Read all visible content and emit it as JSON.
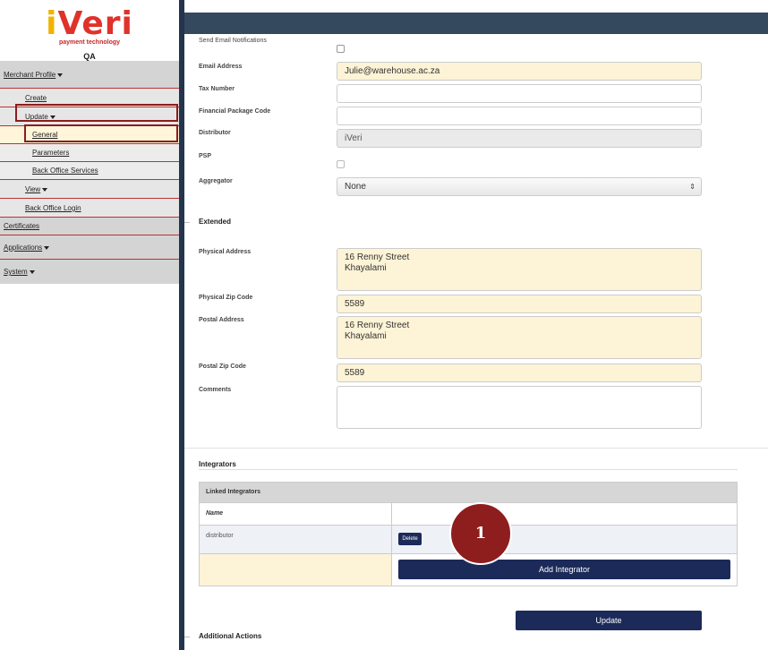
{
  "logo": {
    "text_i": "i",
    "text_rest": "Veri",
    "tagline": "payment technology"
  },
  "environment": "QA",
  "nav": {
    "merchant_profile": "Merchant Profile",
    "create": "Create",
    "update": "Update",
    "general": "General",
    "parameters": "Parameters",
    "back_office_services": "Back Office Services",
    "view": "View",
    "back_office_login": "Back Office Login",
    "certificates": "Certificates",
    "applications": "Applications",
    "system": "System"
  },
  "form": {
    "send_email_notifications": {
      "label": "Send Email Notifications",
      "checked": false
    },
    "email_address": {
      "label": "Email Address",
      "value": "Julie@warehouse.ac.za"
    },
    "tax_number": {
      "label": "Tax Number",
      "value": ""
    },
    "financial_package_code": {
      "label": "Financial Package Code",
      "value": ""
    },
    "distributor": {
      "label": "Distributor",
      "value": "iVeri"
    },
    "psp": {
      "label": "PSP",
      "checked": false
    },
    "aggregator": {
      "label": "Aggregator",
      "value": "None"
    },
    "extended_section": "Extended",
    "physical_address": {
      "label": "Physical Address",
      "value": "16 Renny Street\nKhayalami"
    },
    "physical_zip": {
      "label": "Physical Zip Code",
      "value": "5589"
    },
    "postal_address": {
      "label": "Postal Address",
      "value": "16 Renny Street\nKhayalami"
    },
    "postal_zip": {
      "label": "Postal Zip Code",
      "value": "5589"
    },
    "comments": {
      "label": "Comments",
      "value": ""
    }
  },
  "integrators": {
    "title": "Integrators",
    "table_header": "Linked Integrators",
    "col_name": "Name",
    "rows": [
      {
        "name": "distributor",
        "action": "Delete"
      }
    ],
    "add_button": "Add Integrator"
  },
  "update_button": "Update",
  "additional_actions": "Additional Actions",
  "step_badge": "1"
}
